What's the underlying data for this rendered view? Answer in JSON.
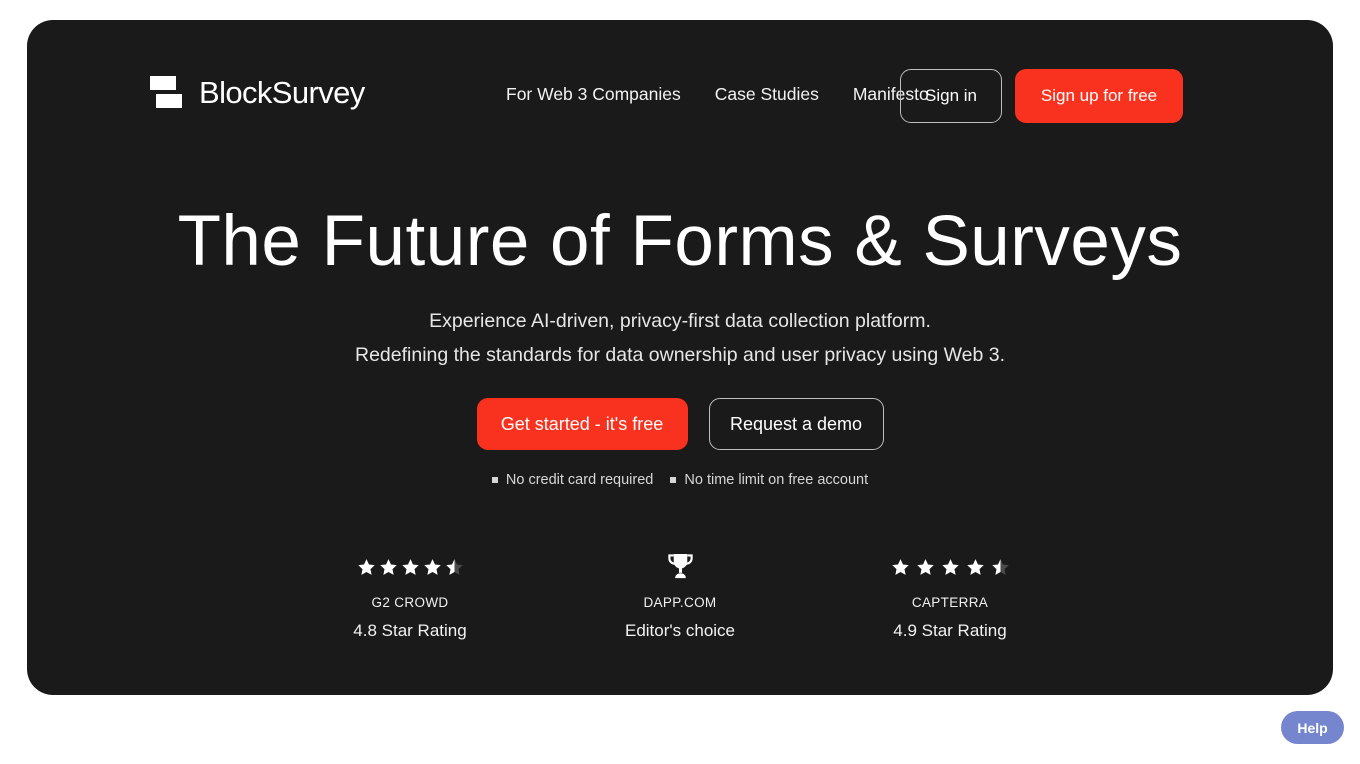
{
  "brand": {
    "name": "BlockSurvey",
    "logo_icon": "blocksurvey-logo-icon"
  },
  "nav": {
    "items": [
      {
        "label": "For Web 3 Companies"
      },
      {
        "label": "Case Studies"
      },
      {
        "label": "Manifesto"
      }
    ]
  },
  "header_actions": {
    "signin_label": "Sign in",
    "signup_label": "Sign up for free"
  },
  "hero": {
    "headline": "The Future of Forms & Surveys",
    "subhead_line1": "Experience AI-driven, privacy-first data collection platform.",
    "subhead_line2": "Redefining the standards for data ownership and user privacy using Web 3.",
    "primary_cta": "Get started - it's free",
    "secondary_cta": "Request a demo",
    "perks": [
      {
        "label": "No credit card required"
      },
      {
        "label": "No time limit on free account"
      }
    ]
  },
  "ratings": [
    {
      "icon": "star-rating-icon",
      "stars": 4.5,
      "source": "G2 CROWD",
      "value": "4.8 Star Rating"
    },
    {
      "icon": "trophy-icon",
      "stars": 0,
      "source": "DAPP.COM",
      "value": "Editor's choice"
    },
    {
      "icon": "star-rating-icon",
      "stars": 4.5,
      "source": "CAPTERRA",
      "value": "4.9 Star Rating"
    }
  ],
  "help": {
    "label": "Help"
  },
  "colors": {
    "page_background": "#ffffff",
    "card_background": "#1a1a1a",
    "accent_red": "#f8321e",
    "help_blue": "#7586cf",
    "text_primary": "#ffffff",
    "text_muted": "#d6d6d6"
  }
}
